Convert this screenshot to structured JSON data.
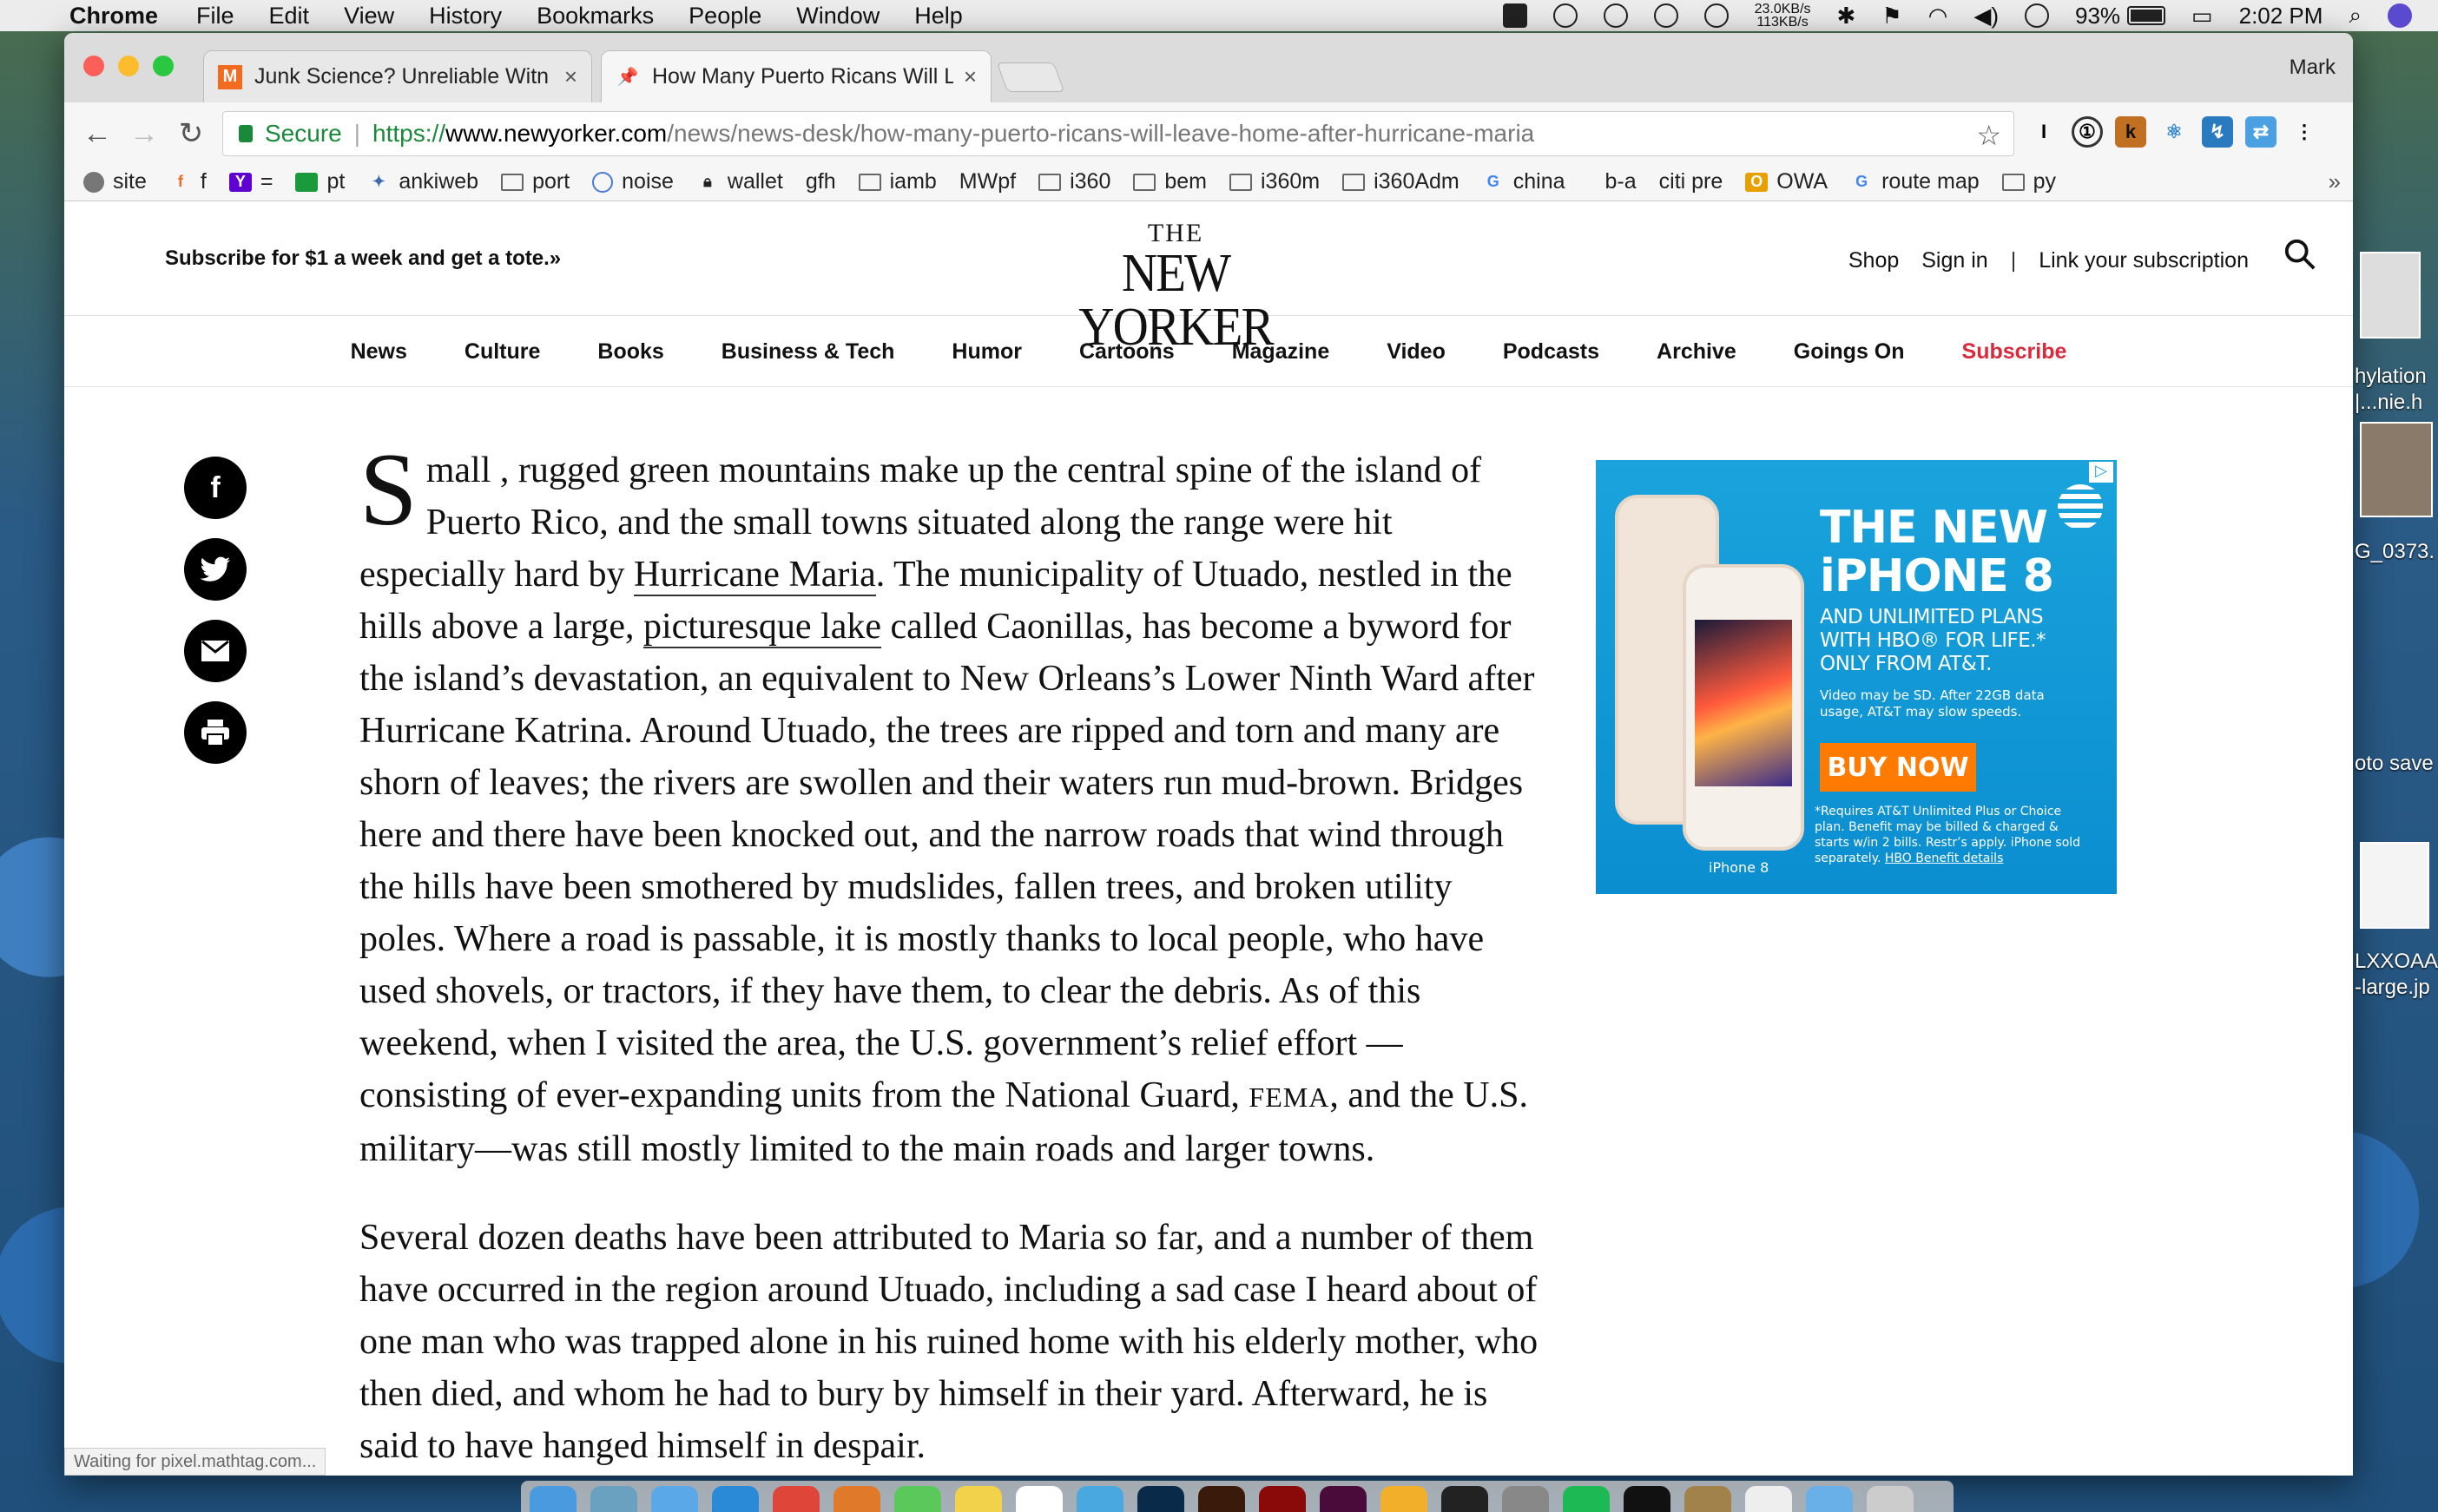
{
  "menubar": {
    "app": "Chrome",
    "items": [
      "File",
      "Edit",
      "View",
      "History",
      "Bookmarks",
      "People",
      "Window",
      "Help"
    ],
    "net_up": "23.0KB/s",
    "net_down": "113KB/s",
    "battery": "93%",
    "clock": "2:02 PM",
    "user": "Mark"
  },
  "tabs": [
    {
      "title": "Junk Science? Unreliable Witn",
      "favicon": "M"
    },
    {
      "title": "How Many Puerto Ricans Will L",
      "favicon": "pin"
    }
  ],
  "toolbar": {
    "secure_label": "Secure",
    "url_protocol": "https://",
    "url_host": "www.newyorker.com",
    "url_path": "/news/news-desk/how-many-puerto-ricans-will-leave-home-after-hurricane-maria"
  },
  "bookmarks": [
    {
      "label": "site",
      "icon": "avatar"
    },
    {
      "label": "f",
      "icon": "f"
    },
    {
      "label": "=",
      "icon": "Y"
    },
    {
      "label": "pt",
      "icon": "green"
    },
    {
      "label": "ankiweb",
      "icon": "anki"
    },
    {
      "label": "port",
      "icon": "folder"
    },
    {
      "label": "noise",
      "icon": "noise"
    },
    {
      "label": "wallet",
      "icon": "lock"
    },
    {
      "label": "gfh",
      "icon": "page"
    },
    {
      "label": "iamb",
      "icon": "folder"
    },
    {
      "label": "MWpf",
      "icon": "page"
    },
    {
      "label": "i360",
      "icon": "folder"
    },
    {
      "label": "bem",
      "icon": "folder"
    },
    {
      "label": "i360m",
      "icon": "folder"
    },
    {
      "label": "i360Adm",
      "icon": "folder"
    },
    {
      "label": "china",
      "icon": "G"
    },
    {
      "label": "b-a",
      "icon": "none"
    },
    {
      "label": "citi pre",
      "icon": "page"
    },
    {
      "label": "OWA",
      "icon": "owa"
    },
    {
      "label": "route map",
      "icon": "G"
    },
    {
      "label": "py",
      "icon": "folder"
    }
  ],
  "site": {
    "promo": "Subscribe for $1 a week and get a tote.»",
    "logo_the": "THE",
    "logo_name": "NEW YORKER",
    "shop": "Shop",
    "sign_in": "Sign in",
    "divider": "|",
    "link_subscription": "Link your subscription",
    "nav": [
      "News",
      "Culture",
      "Books",
      "Business & Tech",
      "Humor",
      "Cartoons",
      "Magazine",
      "Video",
      "Podcasts",
      "Archive",
      "Goings On"
    ],
    "nav_subscribe": "Subscribe",
    "subscribe_color": "#d9293b"
  },
  "article": {
    "dropcap": "S",
    "p1_a": "mall , rugged green mountains make up the central spine of the island of Puerto Rico, and the small towns situated along the range were hit especially hard by ",
    "p1_link1": "Hurricane Maria",
    "p1_b": ". The municipality of Utuado, nestled in the hills above a large, ",
    "p1_link2": "picturesque lake",
    "p1_c": " called Caonillas, has become a byword for the island’s devastation, an equivalent to New Orleans’s Lower Ninth Ward after Hurricane Katrina. Around Utuado, the trees are ripped and torn and many are shorn of leaves; the rivers are swollen and their waters run mud-brown. Bridges here and there have been knocked out, and the narrow roads that wind through the hills have been smothered by mudslides, fallen trees, and broken utility poles. Where a road is passable, it is mostly thanks to local people, who have used shovels, or tractors, if they have them, to clear the debris. As of this weekend, when I visited the area, the U.S. government’s relief effort —consisting of ever-expanding units from the National Guard, ",
    "p1_fema": "FEMA",
    "p1_d": ", and the U.S. military—was still mostly limited to the main roads and larger towns.",
    "p2": "Several dozen deaths have been attributed to Maria so far, and a number of them have occurred in the region around Utuado, including a sad case I heard about of one man who was trapped alone in his ruined home with his elderly mother, who then died, and whom he had to bury by himself in their yard. Afterward, he is said to have hanged himself in despair."
  },
  "ad": {
    "headline1": "THE NEW",
    "headline2": "iPHONE 8",
    "sub": "AND UNLIMITED PLANS WITH HBO® FOR LIFE.* ONLY FROM AT&T.",
    "small": "Video may be SD. After 22GB data usage, AT&T may slow speeds.",
    "cta": "BUY NOW",
    "fine": "*Requires AT&T Unlimited Plus or Choice plan. Benefit may be billed & charged & starts w/in 2 bills. Restr’s apply. iPhone sold separately.",
    "fine_link": "HBO Benefit details",
    "phone_label": "iPhone 8",
    "accent": "#ff7a00",
    "bg": "#1aa3dc"
  },
  "status_text": "Waiting for pixel.mathtag.com...",
  "desktop": {
    "labels": [
      "hylation",
      "|...nie.h",
      "G_0373.",
      "oto save",
      "LXXOAA",
      "-large.jp"
    ]
  }
}
